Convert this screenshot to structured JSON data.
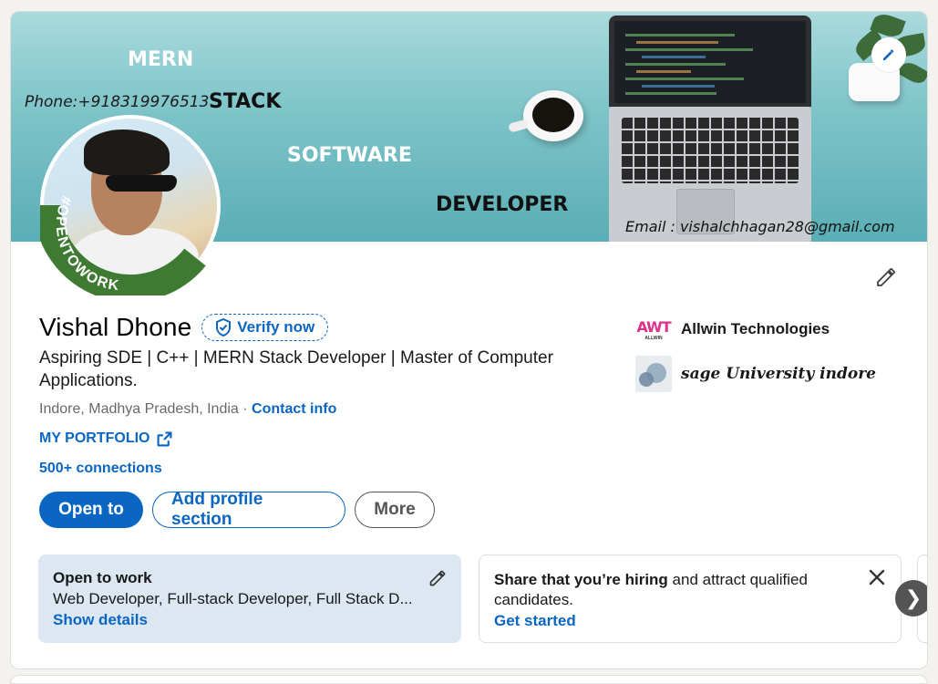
{
  "banner": {
    "line_mern": "MERN",
    "phone": "Phone:+918319976513",
    "line_stack": "STACK",
    "line_software": "SOFTWARE",
    "line_developer": "DEVELOPER",
    "email": "Email : vishalchhagan28@gmail.com",
    "colors": {
      "background": "#7cc3c8"
    }
  },
  "profile": {
    "name": "Vishal Dhone",
    "verify_label": "Verify now",
    "headline": "Aspiring SDE | C++ | MERN Stack Developer | Master of Computer Applications.",
    "location": "Indore, Madhya Pradesh, India",
    "location_sep": " · ",
    "contact_info": "Contact info",
    "portfolio": "MY PORTFOLIO",
    "connections": "500+ connections",
    "open_to_work_badge": "#OPENTOWORK"
  },
  "actions": {
    "open_to": "Open to",
    "add_section": "Add profile section",
    "more": "More"
  },
  "experience": [
    {
      "name": "Allwin Technologies",
      "logo_text_a": "AW",
      "logo_text_b": "T",
      "logo_sub": "ALLWIN"
    },
    {
      "name": "sage University indore"
    }
  ],
  "cards": {
    "open_to_work": {
      "title": "Open to work",
      "desc": "Web Developer, Full-stack Developer, Full Stack D...",
      "link": "Show details"
    },
    "hiring": {
      "bold": "Share that you’re hiring",
      "rest": " and attract qualified candidates.",
      "link": "Get started"
    },
    "next": "❯"
  },
  "colors": {
    "primary": "#0a66c2",
    "open_to_work_green": "#3f7a33",
    "card_blue": "#dde7f1"
  },
  "icons": [
    "pencil-icon",
    "shield-check-icon",
    "external-link-icon",
    "close-icon",
    "chevron-right-icon"
  ]
}
